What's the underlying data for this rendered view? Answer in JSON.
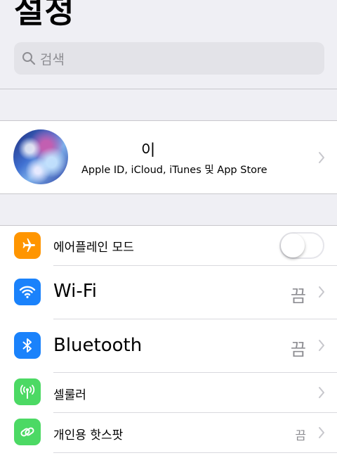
{
  "header": {
    "title": "설정"
  },
  "search": {
    "placeholder": "검색"
  },
  "profile": {
    "name": "이",
    "subtitle": "Apple ID, iCloud, iTunes 및 App Store"
  },
  "settings": {
    "airplane": {
      "label": "에어플레인 모드",
      "icon": "airplane-icon",
      "color": "#ff9500",
      "toggle_on": false
    },
    "wifi": {
      "label": "Wi-Fi",
      "value": "끔",
      "icon": "wifi-icon",
      "color": "#1a82fb"
    },
    "bluetooth": {
      "label": "Bluetooth",
      "value": "끔",
      "icon": "bluetooth-icon",
      "color": "#1a82fb"
    },
    "cellular": {
      "label": "셀룰러",
      "icon": "antenna-icon",
      "color": "#4cd964"
    },
    "hotspot": {
      "label": "개인용 핫스팟",
      "value": "끔",
      "icon": "hotspot-icon",
      "color": "#4cd964"
    }
  }
}
